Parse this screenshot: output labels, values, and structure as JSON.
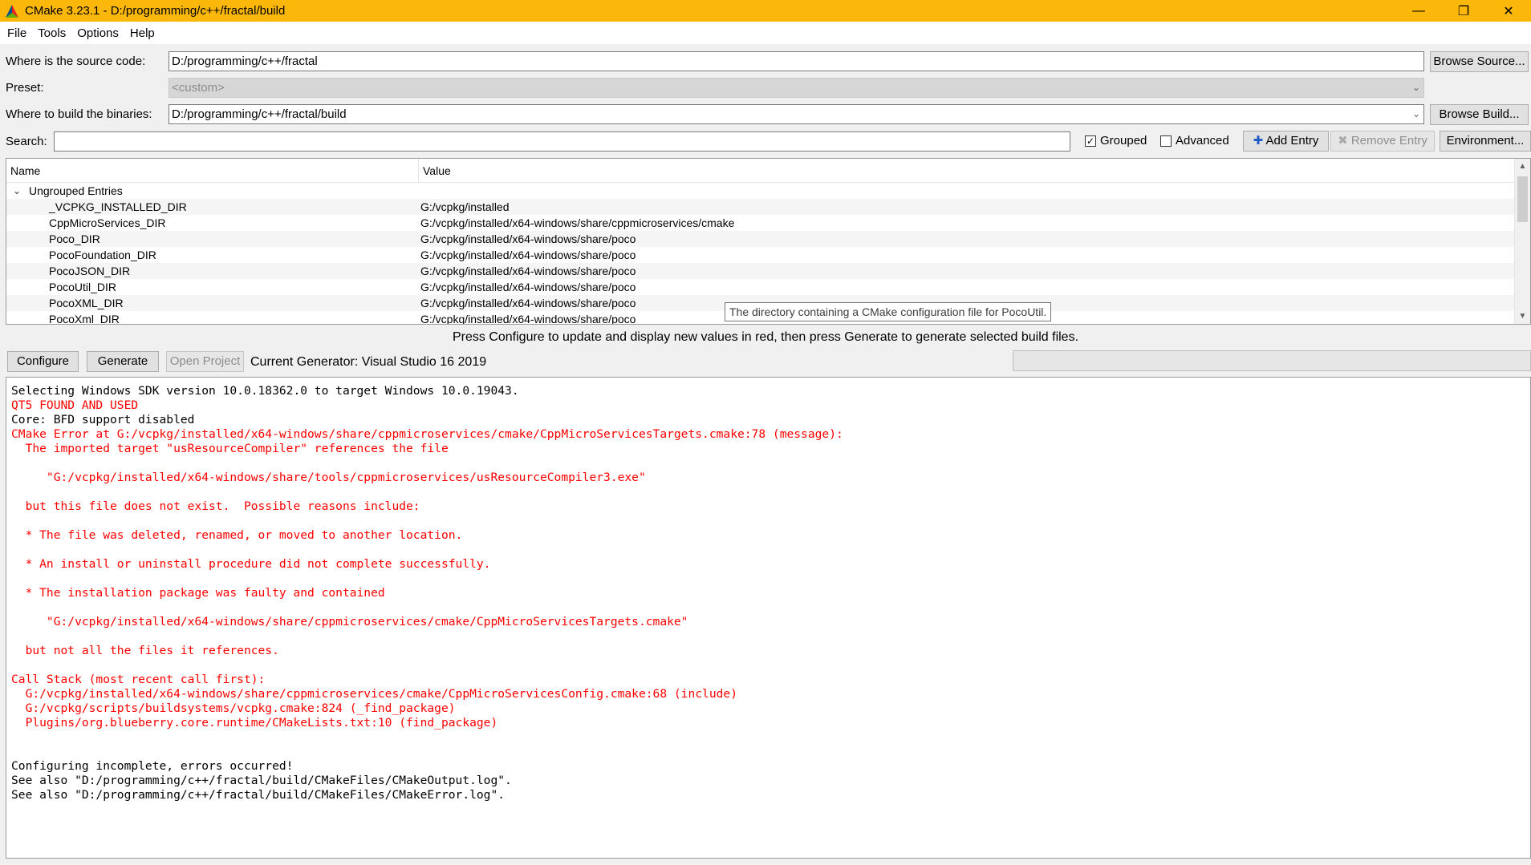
{
  "window": {
    "title": "CMake 3.23.1 - D:/programming/c++/fractal/build",
    "minimize": "—",
    "restore": "❐",
    "close": "✕"
  },
  "menu": [
    "File",
    "Tools",
    "Options",
    "Help"
  ],
  "source": {
    "label": "Where is the source code:",
    "value": "D:/programming/c++/fractal",
    "browse": "Browse Source..."
  },
  "preset": {
    "label": "Preset:",
    "value": "<custom>"
  },
  "build": {
    "label": "Where to build the binaries:",
    "value": "D:/programming/c++/fractal/build",
    "browse": "Browse Build..."
  },
  "search": {
    "label": "Search:",
    "value": ""
  },
  "options": {
    "grouped": {
      "label": "Grouped",
      "checked": true
    },
    "advanced": {
      "label": "Advanced",
      "checked": false
    },
    "add_entry": "Add Entry",
    "remove_entry": "Remove Entry",
    "environment": "Environment..."
  },
  "table": {
    "col_name": "Name",
    "col_value": "Value",
    "group": "Ungrouped Entries",
    "rows": [
      {
        "name": "_VCPKG_INSTALLED_DIR",
        "value": "G:/vcpkg/installed"
      },
      {
        "name": "CppMicroServices_DIR",
        "value": "G:/vcpkg/installed/x64-windows/share/cppmicroservices/cmake"
      },
      {
        "name": "Poco_DIR",
        "value": "G:/vcpkg/installed/x64-windows/share/poco"
      },
      {
        "name": "PocoFoundation_DIR",
        "value": "G:/vcpkg/installed/x64-windows/share/poco"
      },
      {
        "name": "PocoJSON_DIR",
        "value": "G:/vcpkg/installed/x64-windows/share/poco"
      },
      {
        "name": "PocoUtil_DIR",
        "value": "G:/vcpkg/installed/x64-windows/share/poco"
      },
      {
        "name": "PocoXML_DIR",
        "value": "G:/vcpkg/installed/x64-windows/share/poco"
      },
      {
        "name": "PocoXml_DIR",
        "value": "G:/vcpkg/installed/x64-windows/share/poco"
      }
    ]
  },
  "tooltip": "The directory containing a CMake configuration file for PocoUtil.",
  "hint": "Press Configure to update and display new values in red, then press Generate to generate selected build files.",
  "actions": {
    "configure": "Configure",
    "generate": "Generate",
    "open_project": "Open Project",
    "generator": "Current Generator: Visual Studio 16 2019"
  },
  "log": [
    {
      "t": "Selecting Windows SDK version 10.0.18362.0 to target Windows 10.0.19043.",
      "c": "black"
    },
    {
      "t": "QT5 FOUND AND USED",
      "c": "red"
    },
    {
      "t": "Core: BFD support disabled",
      "c": "black"
    },
    {
      "t": "CMake Error at G:/vcpkg/installed/x64-windows/share/cppmicroservices/cmake/CppMicroServicesTargets.cmake:78 (message):",
      "c": "red"
    },
    {
      "t": "  The imported target \"usResourceCompiler\" references the file",
      "c": "red"
    },
    {
      "t": "",
      "c": "red"
    },
    {
      "t": "     \"G:/vcpkg/installed/x64-windows/share/tools/cppmicroservices/usResourceCompiler3.exe\"",
      "c": "red"
    },
    {
      "t": "",
      "c": "red"
    },
    {
      "t": "  but this file does not exist.  Possible reasons include:",
      "c": "red"
    },
    {
      "t": "",
      "c": "red"
    },
    {
      "t": "  * The file was deleted, renamed, or moved to another location.",
      "c": "red"
    },
    {
      "t": "",
      "c": "red"
    },
    {
      "t": "  * An install or uninstall procedure did not complete successfully.",
      "c": "red"
    },
    {
      "t": "",
      "c": "red"
    },
    {
      "t": "  * The installation package was faulty and contained",
      "c": "red"
    },
    {
      "t": "",
      "c": "red"
    },
    {
      "t": "     \"G:/vcpkg/installed/x64-windows/share/cppmicroservices/cmake/CppMicroServicesTargets.cmake\"",
      "c": "red"
    },
    {
      "t": "",
      "c": "red"
    },
    {
      "t": "  but not all the files it references.",
      "c": "red"
    },
    {
      "t": "",
      "c": "red"
    },
    {
      "t": "Call Stack (most recent call first):",
      "c": "red"
    },
    {
      "t": "  G:/vcpkg/installed/x64-windows/share/cppmicroservices/cmake/CppMicroServicesConfig.cmake:68 (include)",
      "c": "red"
    },
    {
      "t": "  G:/vcpkg/scripts/buildsystems/vcpkg.cmake:824 (_find_package)",
      "c": "red"
    },
    {
      "t": "  Plugins/org.blueberry.core.runtime/CMakeLists.txt:10 (find_package)",
      "c": "red"
    },
    {
      "t": "",
      "c": "black"
    },
    {
      "t": "",
      "c": "black"
    },
    {
      "t": "Configuring incomplete, errors occurred!",
      "c": "black"
    },
    {
      "t": "See also \"D:/programming/c++/fractal/build/CMakeFiles/CMakeOutput.log\".",
      "c": "black"
    },
    {
      "t": "See also \"D:/programming/c++/fractal/build/CMakeFiles/CMakeError.log\".",
      "c": "black"
    }
  ],
  "colors": {
    "titlebar": "#fbb80b",
    "error": "#ff0000"
  }
}
